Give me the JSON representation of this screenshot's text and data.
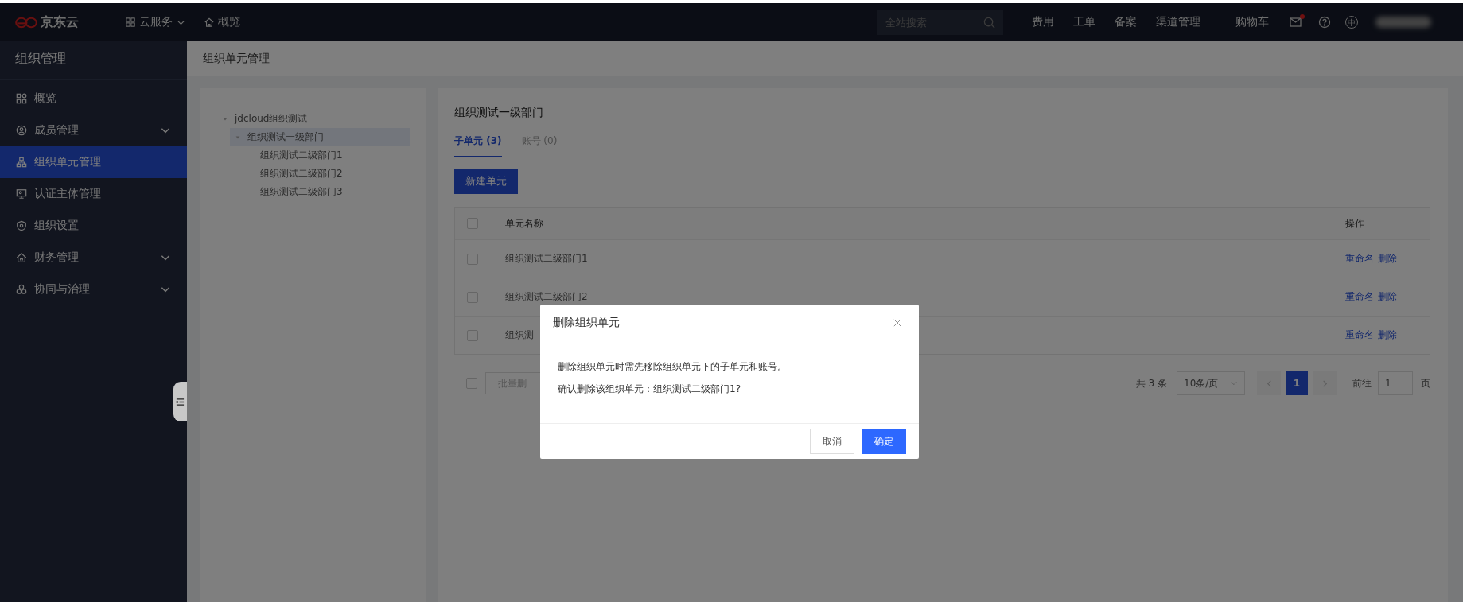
{
  "topbar": {
    "logo": "京东云",
    "nav": [
      {
        "label": "云服务",
        "dropdown": true
      },
      {
        "label": "概览",
        "dropdown": false
      }
    ],
    "search": {
      "placeholder": "全站搜索"
    },
    "links": [
      "费用",
      "工单",
      "备案",
      "渠道管理",
      "购物车"
    ],
    "mail_unread": true,
    "language": "中"
  },
  "sidebar": {
    "title": "组织管理",
    "items": [
      {
        "label": "概览",
        "expandable": false,
        "selected": false
      },
      {
        "label": "成员管理",
        "expandable": true,
        "selected": false
      },
      {
        "label": "组织单元管理",
        "expandable": false,
        "selected": true
      },
      {
        "label": "认证主体管理",
        "expandable": false,
        "selected": false
      },
      {
        "label": "组织设置",
        "expandable": false,
        "selected": false
      },
      {
        "label": "财务管理",
        "expandable": true,
        "selected": false
      },
      {
        "label": "协同与治理",
        "expandable": true,
        "selected": false
      }
    ]
  },
  "page_header": {
    "title": "组织单元管理"
  },
  "tree": [
    {
      "label": "jdcloud组织测试",
      "expanded": true,
      "selected": false,
      "children": [
        {
          "label": "组织测试一级部门",
          "expanded": true,
          "selected": true,
          "children": [
            {
              "label": "组织测试二级部门1",
              "selected": false
            },
            {
              "label": "组织测试二级部门2",
              "selected": false
            },
            {
              "label": "组织测试二级部门3",
              "selected": false
            }
          ]
        }
      ]
    }
  ],
  "detail": {
    "title": "组织测试一级部门",
    "tabs": [
      {
        "label": "子单元 (3)",
        "selected": true
      },
      {
        "label": "账号 (0)",
        "selected": false
      }
    ],
    "new_button": "新建单元",
    "table": {
      "select_all_checked": false,
      "columns": [
        "单元名称",
        "操作"
      ],
      "rows": [
        {
          "name": "组织测试二级部门1",
          "checked": false,
          "actions": [
            "重命名",
            "删除"
          ]
        },
        {
          "name": "组织测试二级部门2",
          "checked": false,
          "actions": [
            "重命名",
            "删除"
          ]
        },
        {
          "name": "组织测",
          "checked": false,
          "actions": [
            "重命名",
            "删除"
          ]
        }
      ]
    },
    "bulk_checked": false,
    "bulk_button": "批量删",
    "pagination": {
      "total": "共 3 条",
      "page_size": "10条/页",
      "pages": [
        {
          "label": "1",
          "selected": true
        }
      ],
      "goto_label": "前往",
      "goto_value": "1",
      "goto_suffix": "页"
    }
  },
  "dialog": {
    "title": "删除组织单元",
    "lines": [
      "删除组织单元时需先移除组织单元下的子单元和账号。",
      "确认删除该组织单元：组织测试二级部门1?"
    ],
    "buttons": [
      {
        "label": "取消",
        "kind": "default"
      },
      {
        "label": "确定",
        "kind": "primary"
      }
    ]
  }
}
